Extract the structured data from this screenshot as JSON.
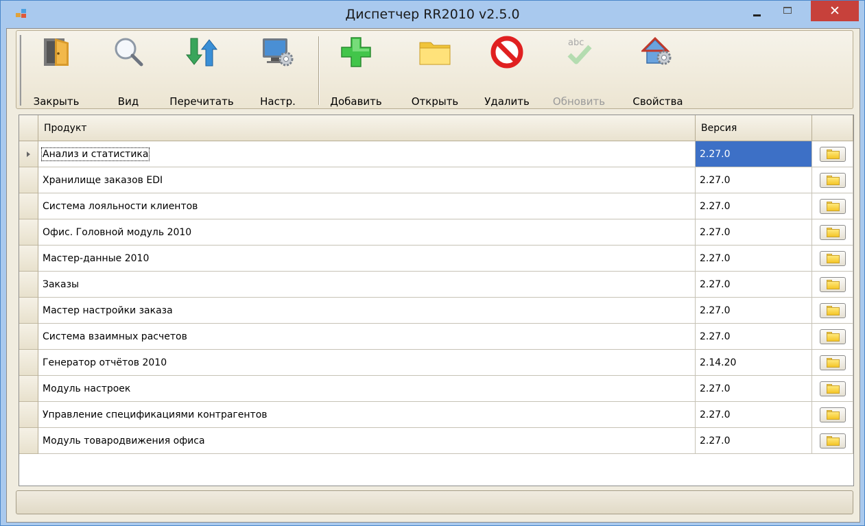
{
  "window": {
    "title": "Диспетчер RR2010 v2.5.0",
    "close_glyph": "✕"
  },
  "toolbar": {
    "close": {
      "label": "Закрыть",
      "icon": "door-icon"
    },
    "view": {
      "label": "Вид",
      "icon": "magnifier-icon"
    },
    "reread": {
      "label": "Перечитать",
      "icon": "refresh-arrows-icon"
    },
    "settings": {
      "label": "Настр.",
      "icon": "monitor-gear-icon"
    },
    "add": {
      "label": "Добавить",
      "icon": "plus-icon"
    },
    "open": {
      "label": "Открыть",
      "icon": "folder-icon"
    },
    "delete": {
      "label": "Удалить",
      "icon": "forbidden-icon"
    },
    "update": {
      "label": "Обновить",
      "icon": "abc-check-icon",
      "disabled": true
    },
    "properties": {
      "label": "Свойства",
      "icon": "house-gear-icon"
    }
  },
  "grid": {
    "columns": {
      "product": "Продукт",
      "version": "Версия"
    },
    "rows": [
      {
        "product": "Анализ и статистика",
        "version": "2.27.0",
        "selected": true
      },
      {
        "product": "Хранилище заказов EDI",
        "version": "2.27.0"
      },
      {
        "product": "Система лояльности клиентов",
        "version": "2.27.0"
      },
      {
        "product": "Офис. Головной модуль 2010",
        "version": "2.27.0"
      },
      {
        "product": "Мастер-данные 2010",
        "version": "2.27.0"
      },
      {
        "product": "Заказы",
        "version": "2.27.0"
      },
      {
        "product": "Мастер настройки заказа",
        "version": "2.27.0"
      },
      {
        "product": "Система взаимных расчетов",
        "version": "2.27.0"
      },
      {
        "product": "Генератор отчётов 2010",
        "version": "2.14.20"
      },
      {
        "product": "Модуль настроек",
        "version": "2.27.0"
      },
      {
        "product": "Управление спецификациями контрагентов",
        "version": "2.27.0"
      },
      {
        "product": "Модуль товародвижения офиса",
        "version": "2.27.0"
      }
    ]
  },
  "colors": {
    "selection": "#3d70c6",
    "close_button": "#c7413b",
    "titlebar": "#a9c9ee"
  }
}
